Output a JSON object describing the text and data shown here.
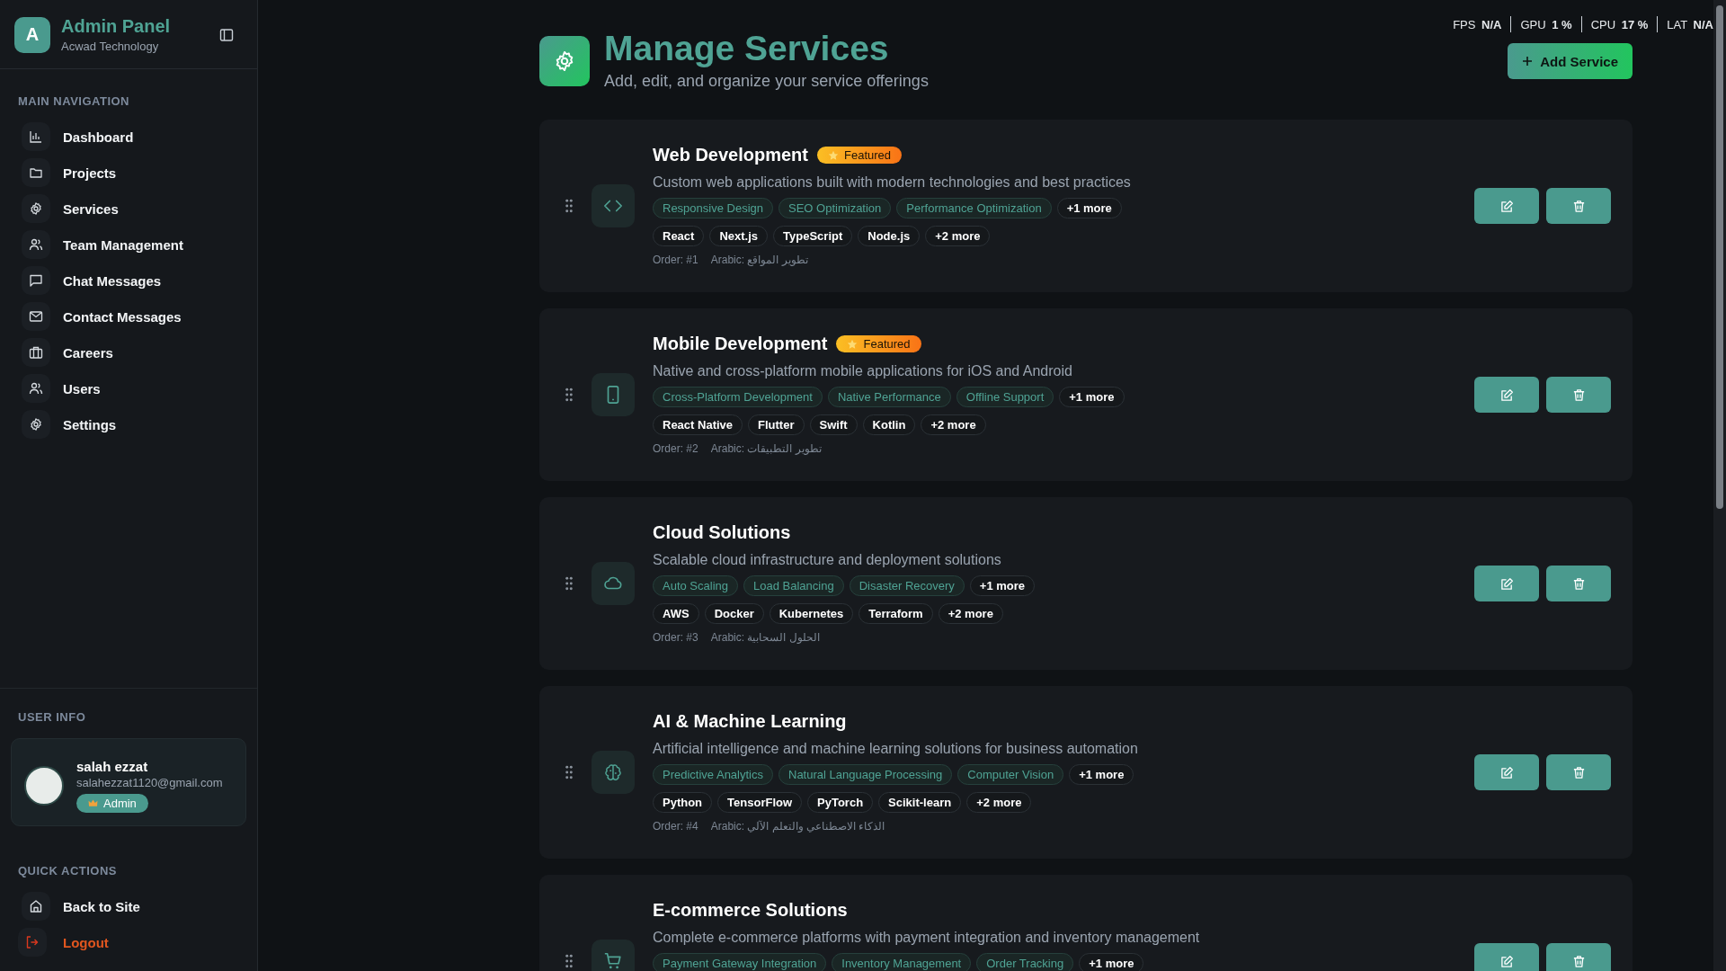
{
  "brand": {
    "initial": "A",
    "title": "Admin Panel",
    "subtitle": "Acwad Technology"
  },
  "nav": {
    "heading": "MAIN NAVIGATION",
    "items": [
      {
        "label": "Dashboard",
        "kind": "chart"
      },
      {
        "label": "Projects",
        "kind": "folder"
      },
      {
        "label": "Services",
        "kind": "gear"
      },
      {
        "label": "Team Management",
        "kind": "users"
      },
      {
        "label": "Chat Messages",
        "kind": "chat"
      },
      {
        "label": "Contact Messages",
        "kind": "mail"
      },
      {
        "label": "Careers",
        "kind": "briefcase"
      },
      {
        "label": "Users",
        "kind": "users"
      },
      {
        "label": "Settings",
        "kind": "gear"
      }
    ]
  },
  "user_info": {
    "heading": "USER INFO",
    "name": "salah ezzat",
    "email": "salahezzat1120@gmail.com",
    "role": "Admin"
  },
  "quick_actions": {
    "heading": "QUICK ACTIONS",
    "items": [
      {
        "label": "Back to Site",
        "kind": "home"
      },
      {
        "label": "Logout",
        "kind": "logout"
      }
    ]
  },
  "stats": [
    {
      "label": "FPS",
      "value": "N/A"
    },
    {
      "label": "GPU",
      "value": "1 %"
    },
    {
      "label": "CPU",
      "value": "17 %"
    },
    {
      "label": "LAT",
      "value": "N/A"
    }
  ],
  "header": {
    "title": "Manage Services",
    "subtitle": "Add, edit, and organize your service offerings",
    "add_button": "Add Service"
  },
  "services": [
    {
      "title": "Web Development",
      "featured": true,
      "featured_label": "Featured",
      "kind": "code",
      "description": "Custom web applications built with modern technologies and best practices",
      "features": [
        "Responsive Design",
        "SEO Optimization",
        "Performance Optimization"
      ],
      "features_more": "+1 more",
      "tech": [
        "React",
        "Next.js",
        "TypeScript",
        "Node.js"
      ],
      "tech_more": "+2 more",
      "order": "Order: #1",
      "arabic": "Arabic: تطوير المواقع"
    },
    {
      "title": "Mobile Development",
      "featured": true,
      "featured_label": "Featured",
      "kind": "phone",
      "description": "Native and cross-platform mobile applications for iOS and Android",
      "features": [
        "Cross-Platform Development",
        "Native Performance",
        "Offline Support"
      ],
      "features_more": "+1 more",
      "tech": [
        "React Native",
        "Flutter",
        "Swift",
        "Kotlin"
      ],
      "tech_more": "+2 more",
      "order": "Order: #2",
      "arabic": "Arabic: تطوير التطبيقات"
    },
    {
      "title": "Cloud Solutions",
      "featured": false,
      "kind": "cloud",
      "description": "Scalable cloud infrastructure and deployment solutions",
      "features": [
        "Auto Scaling",
        "Load Balancing",
        "Disaster Recovery"
      ],
      "features_more": "+1 more",
      "tech": [
        "AWS",
        "Docker",
        "Kubernetes",
        "Terraform"
      ],
      "tech_more": "+2 more",
      "order": "Order: #3",
      "arabic": "Arabic: الحلول السحابية"
    },
    {
      "title": "AI & Machine Learning",
      "featured": false,
      "kind": "brain",
      "description": "Artificial intelligence and machine learning solutions for business automation",
      "features": [
        "Predictive Analytics",
        "Natural Language Processing",
        "Computer Vision"
      ],
      "features_more": "+1 more",
      "tech": [
        "Python",
        "TensorFlow",
        "PyTorch",
        "Scikit-learn"
      ],
      "tech_more": "+2 more",
      "order": "Order: #4",
      "arabic": "Arabic: الذكاء الاصطناعي والتعلم الآلي"
    },
    {
      "title": "E-commerce Solutions",
      "featured": false,
      "kind": "cart",
      "description": "Complete e-commerce platforms with payment integration and inventory management",
      "features": [
        "Payment Gateway Integration",
        "Inventory Management",
        "Order Tracking"
      ],
      "features_more": "+1 more"
    }
  ]
}
